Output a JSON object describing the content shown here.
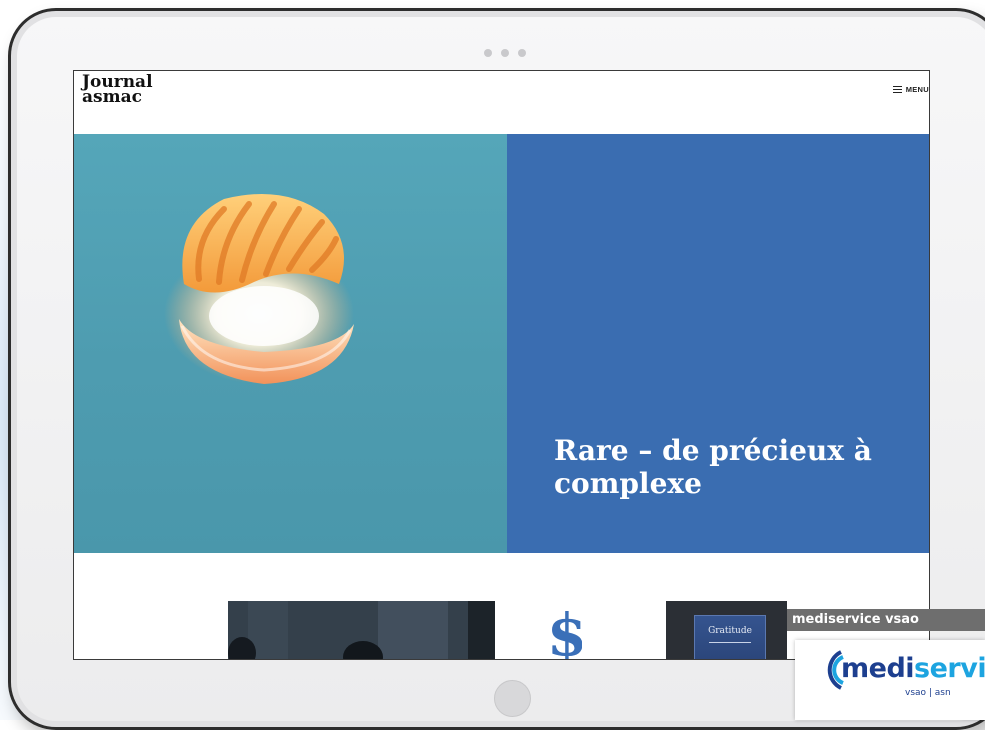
{
  "site": {
    "logo_line1": "Journal",
    "logo_line2": "asmac",
    "menu_label": "MENU"
  },
  "hero": {
    "title": "Rare – de précieux à complexe",
    "image_icon": "shell-illustration",
    "colors": {
      "image_bg": "#55a6b9",
      "panel_bg": "#3a6db1",
      "title": "#ffffff"
    }
  },
  "teasers": [
    {
      "icon": "photo-people"
    },
    {
      "icon": "dollar-sign",
      "symbol": "$"
    },
    {
      "icon": "book-cover",
      "book_title": "Gratitude"
    }
  ],
  "badge": {
    "header": "mediservice vsao",
    "brand_prefix": "medi",
    "brand_suffix": "servic",
    "sub": "vsao | asn"
  }
}
